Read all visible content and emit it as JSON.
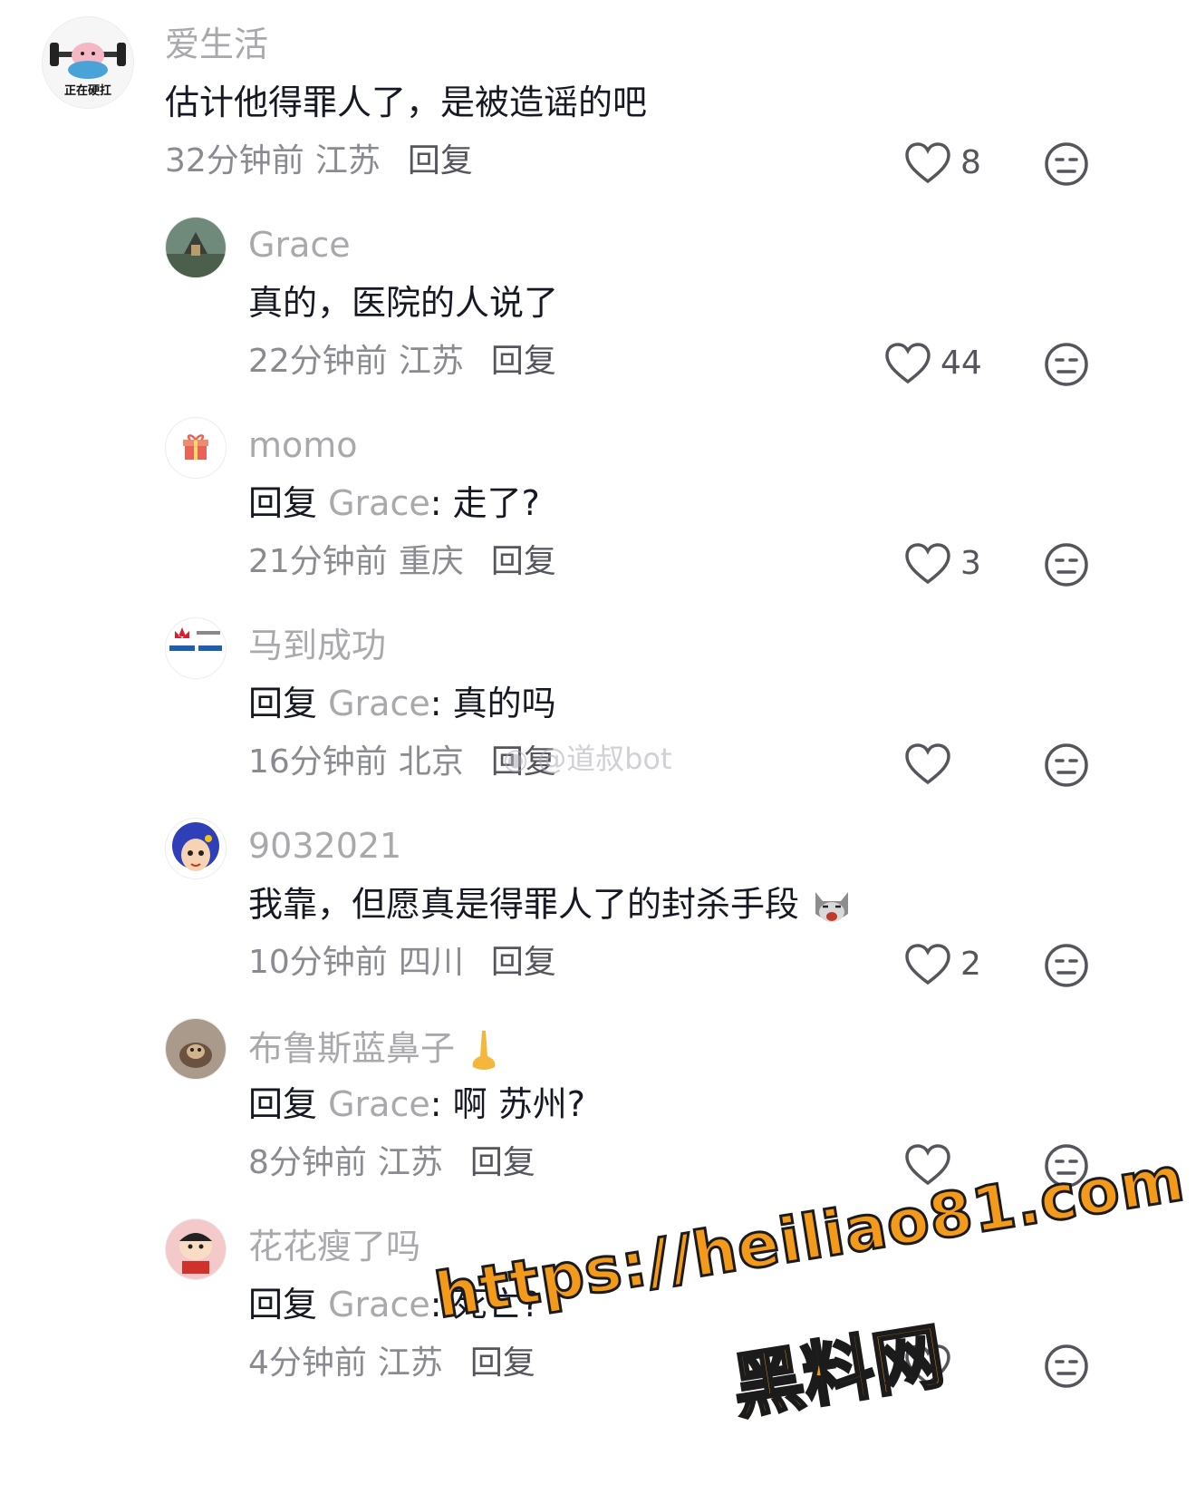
{
  "comments": [
    {
      "username": "爱生活",
      "avatar_label": "正在硬扛",
      "reply_prefix": "",
      "reply_target": "",
      "text": "估计他得罪人了，是被造谣的吧",
      "time": "32分钟前",
      "location": "江苏",
      "reply_label": "回复",
      "likes": "8"
    },
    {
      "username": "Grace",
      "reply_prefix": "",
      "reply_target": "",
      "text": "真的，医院的人说了",
      "time": "22分钟前",
      "location": "江苏",
      "reply_label": "回复",
      "likes": "44"
    },
    {
      "username": "momo",
      "reply_prefix": "回复",
      "reply_target": "Grace",
      "text": ": 走了?",
      "time": "21分钟前",
      "location": "重庆",
      "reply_label": "回复",
      "likes": "3"
    },
    {
      "username": "马到成功",
      "reply_prefix": "回复",
      "reply_target": "Grace",
      "text": ": 真的吗",
      "time": "16分钟前",
      "location": "北京",
      "reply_label": "回复",
      "likes": ""
    },
    {
      "username": "9032021",
      "reply_prefix": "",
      "reply_target": "",
      "text": "我靠，但愿真是得罪人了的封杀手段",
      "time": "10分钟前",
      "location": "四川",
      "reply_label": "回复",
      "likes": "2"
    },
    {
      "username": "布鲁斯蓝鼻子",
      "reply_prefix": "回复",
      "reply_target": "Grace",
      "text": ": 啊 苏州?",
      "time": "8分钟前",
      "location": "江苏",
      "reply_label": "回复",
      "likes": ""
    },
    {
      "username": "花花瘦了吗",
      "reply_prefix": "回复",
      "reply_target": "Grace",
      "text": ": 死亡?",
      "time": "4分钟前",
      "location": "江苏",
      "reply_label": "回复",
      "likes": ""
    }
  ],
  "watermark": "@道叔bot",
  "overlay": {
    "url": "https://heiliao81.com",
    "name": "黑料网"
  },
  "colors": {
    "username": "#a8a8ad",
    "text": "#161823",
    "meta": "#8a8b91",
    "overlay": "#f39a1a"
  }
}
